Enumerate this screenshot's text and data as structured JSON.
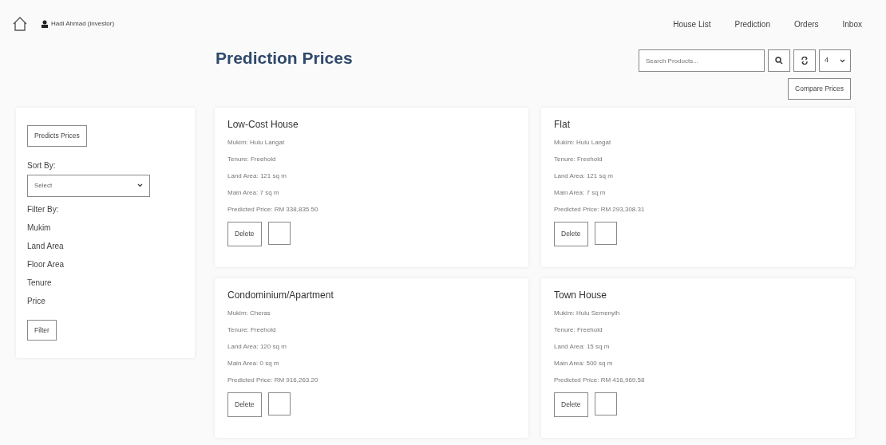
{
  "navbar": {
    "user": "Hadi Ahmad (investor)",
    "links": [
      {
        "label": "House List"
      },
      {
        "label": "Prediction"
      },
      {
        "label": "Orders"
      },
      {
        "label": "Inbox"
      }
    ]
  },
  "page": {
    "title": "Prediction Prices",
    "search": {
      "placeholder": "Search Products..."
    },
    "per_page": "4",
    "compare_button": "Compare Prices"
  },
  "sidebar": {
    "predict_button": "Predicts Prices",
    "sort_label": "Sort By:",
    "sort_select": "Select",
    "filter_label": "Filter By:",
    "filters": [
      "Mukim",
      "Land Area",
      "Floor Area",
      "Tenure",
      "Price"
    ],
    "filter_button": "Filter"
  },
  "cards": [
    {
      "title": "Low-Cost House",
      "lines": [
        "Mukim: Hulu Langat",
        "Tenure: Freehold",
        "Land Area: 121 sq m",
        "Main Area: 7 sq m",
        "Predicted Price: RM 338,835.50"
      ],
      "delete": "Delete"
    },
    {
      "title": "Flat",
      "lines": [
        "Mukim: Hulu Langat",
        "Tenure: Freehold",
        "Land Area: 121 sq m",
        "Main Area: 7 sq m",
        "Predicted Price: RM 293,308.31"
      ],
      "delete": "Delete"
    },
    {
      "title": "Condominium/Apartment",
      "lines": [
        "Mukim: Cheras",
        "Tenure: Freehold",
        "Land Area: 120 sq m",
        "Main Area: 0 sq m",
        "Predicted Price: RM 916,263.20"
      ],
      "delete": "Delete"
    },
    {
      "title": "Town House",
      "lines": [
        "Mukim: Hulu Semenyih",
        "Tenure: Freehold",
        "Land Area: 15 sq m",
        "Main Area: 500 sq m",
        "Predicted Price: RM 416,969.58"
      ],
      "delete": "Delete"
    }
  ]
}
